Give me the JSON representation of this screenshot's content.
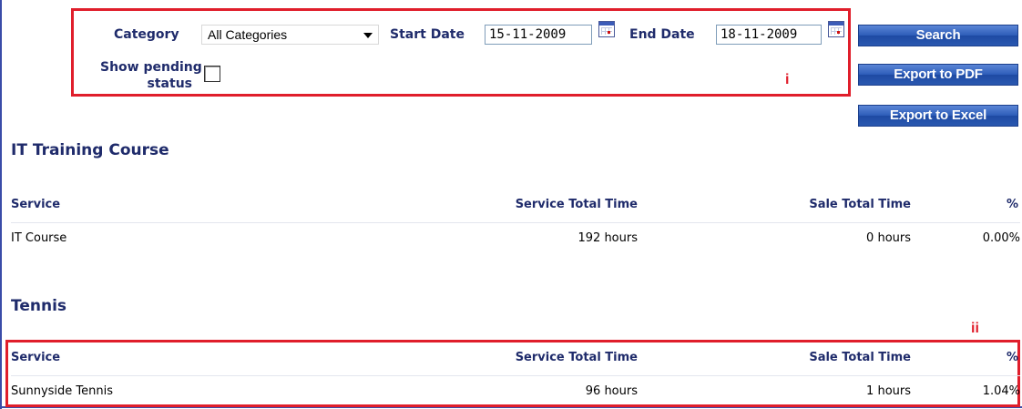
{
  "filters": {
    "category_label": "Category",
    "category_value": "All Categories",
    "start_date_label": "Start Date",
    "start_date_value": "15-11-2009",
    "end_date_label": "End Date",
    "end_date_value": "18-11-2009",
    "pending_label_line1": "Show pending",
    "pending_label_line2": "status",
    "pending_checked": false
  },
  "buttons": {
    "search": "Search",
    "export_pdf": "Export to PDF",
    "export_excel": "Export to Excel"
  },
  "annotations": {
    "marker_i": "i",
    "marker_ii": "ii"
  },
  "sections": [
    {
      "title": "IT Training Course",
      "columns": [
        "Service",
        "Service Total Time",
        "Sale Total Time",
        "%"
      ],
      "rows": [
        {
          "service": "IT Course",
          "service_total_time": "192 hours",
          "sale_total_time": "0 hours",
          "percent": "0.00%"
        }
      ]
    },
    {
      "title": "Tennis",
      "columns": [
        "Service",
        "Service Total Time",
        "Sale Total Time",
        "%"
      ],
      "rows": [
        {
          "service": "Sunnyside Tennis",
          "service_total_time": "96 hours",
          "sale_total_time": "1 hours",
          "percent": "1.04%"
        }
      ]
    }
  ],
  "colors": {
    "heading": "#1f2b6b",
    "annotation_red": "#e01e2b",
    "button_blue": "#2d5cb8"
  }
}
